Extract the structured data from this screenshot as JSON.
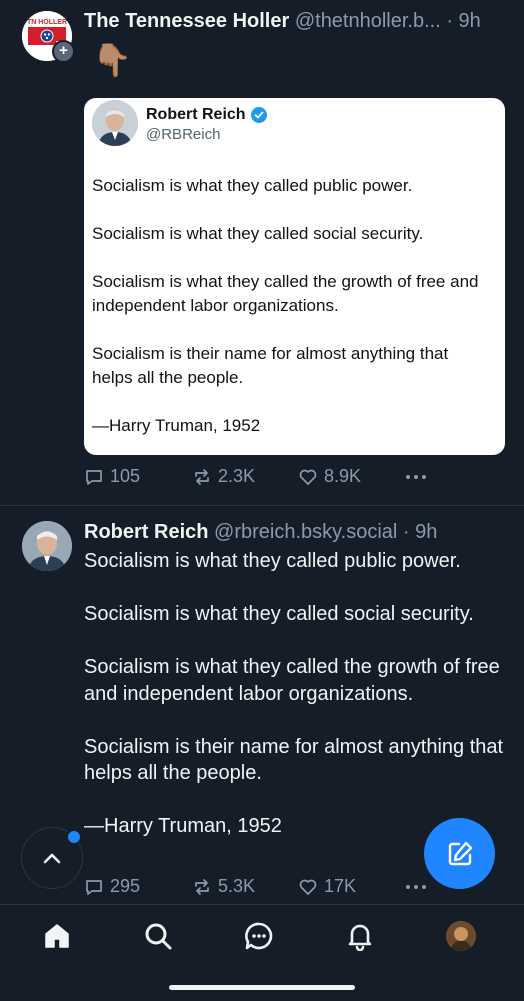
{
  "post1": {
    "author_name": "The Tennessee Holler",
    "author_handle": "@thetnholler.b...",
    "time": "· 9h",
    "avatar_text": "TN HOLLER",
    "emoji": "👇🏽",
    "quote": {
      "author_name": "Robert Reich",
      "author_handle": "@RBReich",
      "paragraphs": [
        "Socialism is what they called public power.",
        "Socialism is what they called social security.",
        "Socialism is what they called the growth of free and independent labor organizations.",
        "Socialism is their name for almost anything that helps all the people.",
        "—Harry Truman, 1952"
      ]
    },
    "actions": {
      "replies": "105",
      "reposts": "2.3K",
      "likes": "8.9K"
    }
  },
  "post2": {
    "author_name": "Robert Reich",
    "author_handle": "@rbreich.bsky.social",
    "time": "· 9h",
    "paragraphs": [
      "Socialism is what they called public power.",
      "Socialism is what they called social security.",
      "Socialism is what they called the growth of free and independent labor organizations.",
      "Socialism is their name for almost anything that helps all the people.",
      "—Harry Truman, 1952"
    ],
    "actions": {
      "replies": "295",
      "reposts": "5.3K",
      "likes": "17K"
    }
  },
  "icons": {
    "reply": "speech-bubble-icon",
    "repost": "repost-icon",
    "like": "heart-icon",
    "more": "ellipsis-icon",
    "compose": "pencil-square-icon",
    "scroll_top": "chevron-up-icon",
    "tabs": [
      "home-icon",
      "search-icon",
      "chat-icon",
      "bell-icon",
      "profile-avatar"
    ]
  },
  "colors": {
    "background": "#151d28",
    "accent": "#1f86ff",
    "muted": "#8c9aab"
  }
}
